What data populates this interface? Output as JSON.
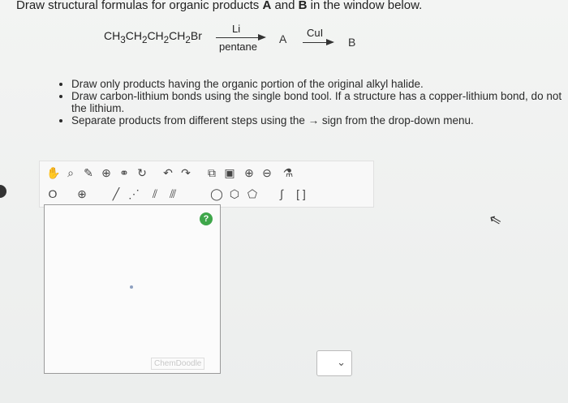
{
  "header": {
    "prefix": "Draw structural formulas for organic products ",
    "a": "A",
    "mid": " and ",
    "b": "B",
    "suffix": " in the window below."
  },
  "reaction": {
    "reactant": "CH3CH2CH2CH2Br",
    "reagent1_top": "Li",
    "reagent1_bottom": "pentane",
    "product1": "A",
    "reagent2_top": "CuI",
    "product2": "B"
  },
  "bullets": [
    "Draw only products having the organic portion of the original alkyl halide.",
    "Draw carbon-lithium bonds using the single bond tool. If a structure has a copper-lithium bond, do not",
    "the lithium.",
    "Separate products from different steps using the → sign from the drop-down menu."
  ],
  "canvas": {
    "help": "?",
    "brand": "ChemDoodle"
  },
  "select": {
    "value": ""
  }
}
